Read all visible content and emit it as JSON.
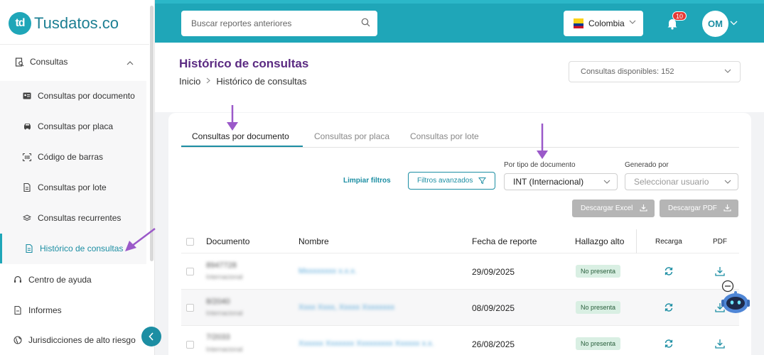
{
  "app": {
    "logo_mark": "td",
    "logo_name": "Tusdatos",
    "logo_tld": ".co",
    "brand_color": "#1fa6b8",
    "title_color": "#5b2a82"
  },
  "sidebar": {
    "consultas_label": "Consultas",
    "sub_items": [
      {
        "label": "Consultas por documento",
        "icon": "id-card-icon"
      },
      {
        "label": "Consultas por placa",
        "icon": "car-icon"
      },
      {
        "label": "Código de barras",
        "icon": "barcode-icon"
      },
      {
        "label": "Consultas por lote",
        "icon": "file-icon"
      },
      {
        "label": "Consultas recurrentes",
        "icon": "layers-icon"
      },
      {
        "label": "Histórico de consultas",
        "icon": "document-icon",
        "active": true
      }
    ],
    "items": [
      {
        "label": "Centro de ayuda",
        "icon": "headset-icon"
      },
      {
        "label": "Informes",
        "icon": "report-icon"
      },
      {
        "label": "Jurisdicciones de alto riesgo",
        "icon": "globe-icon"
      }
    ]
  },
  "topbar": {
    "search_placeholder": "Buscar reportes anteriores",
    "country": "Colombia",
    "notification_count": "10",
    "avatar_initials": "OM"
  },
  "header": {
    "title": "Histórico de consultas",
    "breadcrumb_home": "Inicio",
    "breadcrumb_current": "Histórico de consultas",
    "credits": "Consultas disponibles: 152"
  },
  "tabs": [
    {
      "label": "Consultas por documento",
      "active": true
    },
    {
      "label": "Consultas por placa",
      "active": false
    },
    {
      "label": "Consultas por lote",
      "active": false
    }
  ],
  "filters": {
    "clear_label": "Limpiar filtros",
    "advanced_label": "Filtros avanzados",
    "doc_type_label": "Por tipo de documento",
    "doc_type_value": "INT (Internacional)",
    "generated_label": "Generado por",
    "generated_placeholder": "Seleccionar usuario",
    "excel_label": "Descargar Excel",
    "pdf_label": "Descargar PDF"
  },
  "table": {
    "columns": [
      "Documento",
      "Nombre",
      "Fecha de reporte",
      "Hallazgo alto",
      "Recarga",
      "PDF"
    ],
    "rows": [
      {
        "doc": "8947728",
        "type": "Internacional",
        "name": "Mxxxxxxxx x.x.x.",
        "date": "29/09/2025",
        "hallazgo": "No presenta"
      },
      {
        "doc": "8/2040",
        "type": "Internacional",
        "name": "Xxxx Xxxx, Xxxxx Xxxxxxxx",
        "date": "08/09/2025",
        "hallazgo": "No presenta"
      },
      {
        "doc": "7/2033",
        "type": "Internacional",
        "name": "Xxxxxx Xxxxxxx Xxxxxxxxx Xxxxxx x.x.",
        "date": "26/08/2025",
        "hallazgo": "No presenta"
      }
    ]
  }
}
